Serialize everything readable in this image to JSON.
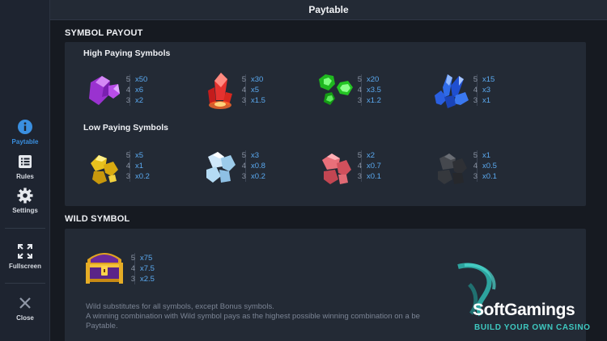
{
  "header": {
    "title": "Paytable"
  },
  "sidebar": {
    "items": [
      {
        "label": "Paytable",
        "icon": "info-icon",
        "active": true
      },
      {
        "label": "Rules",
        "icon": "list-icon"
      },
      {
        "label": "Settings",
        "icon": "gear-icon"
      },
      {
        "label": "Fullscreen",
        "icon": "fullscreen-icon"
      },
      {
        "label": "Close",
        "icon": "close-icon"
      }
    ]
  },
  "symbol_payout": {
    "title": "SYMBOL PAYOUT",
    "high": {
      "title": "High Paying Symbols",
      "symbols": [
        {
          "icon": "purple-crystal-icon",
          "color": "#b84de8",
          "pays": [
            {
              "n": "5",
              "v": "x50"
            },
            {
              "n": "4",
              "v": "x6"
            },
            {
              "n": "3",
              "v": "x2"
            }
          ]
        },
        {
          "icon": "red-crystal-icon",
          "color": "#e5322f",
          "pays": [
            {
              "n": "5",
              "v": "x30"
            },
            {
              "n": "4",
              "v": "x5"
            },
            {
              "n": "3",
              "v": "x1.5"
            }
          ]
        },
        {
          "icon": "green-gem-icon",
          "color": "#2fd12f",
          "pays": [
            {
              "n": "5",
              "v": "x20"
            },
            {
              "n": "4",
              "v": "x3.5"
            },
            {
              "n": "3",
              "v": "x1.2"
            }
          ]
        },
        {
          "icon": "blue-crystal-icon",
          "color": "#2f6be8",
          "pays": [
            {
              "n": "5",
              "v": "x15"
            },
            {
              "n": "4",
              "v": "x3"
            },
            {
              "n": "3",
              "v": "x1"
            }
          ]
        }
      ]
    },
    "low": {
      "title": "Low Paying Symbols",
      "symbols": [
        {
          "icon": "gold-ore-icon",
          "color": "#e8c21e",
          "pays": [
            {
              "n": "5",
              "v": "x5"
            },
            {
              "n": "4",
              "v": "x1"
            },
            {
              "n": "3",
              "v": "x0.2"
            }
          ]
        },
        {
          "icon": "ice-ore-icon",
          "color": "#a8d3ee",
          "pays": [
            {
              "n": "5",
              "v": "x3"
            },
            {
              "n": "4",
              "v": "x0.8"
            },
            {
              "n": "3",
              "v": "x0.2"
            }
          ]
        },
        {
          "icon": "red-ore-icon",
          "color": "#e0606a",
          "pays": [
            {
              "n": "5",
              "v": "x2"
            },
            {
              "n": "4",
              "v": "x0.7"
            },
            {
              "n": "3",
              "v": "x0.1"
            }
          ]
        },
        {
          "icon": "coal-ore-icon",
          "color": "#3a3d42",
          "pays": [
            {
              "n": "5",
              "v": "x1"
            },
            {
              "n": "4",
              "v": "x0.5"
            },
            {
              "n": "3",
              "v": "x0.1"
            }
          ]
        }
      ]
    }
  },
  "wild": {
    "title": "WILD SYMBOL",
    "icon": "treasure-chest-icon",
    "pays": [
      {
        "n": "5",
        "v": "x75"
      },
      {
        "n": "4",
        "v": "x7.5"
      },
      {
        "n": "3",
        "v": "x2.5"
      }
    ],
    "text_lines": [
      "Wild substitutes for all symbols, except Bonus symbols.",
      "A winning combination with Wild symbol pays as the highest possible winning combination on a be",
      "Paytable."
    ]
  },
  "watermark": {
    "name": "SoftGamings",
    "tagline": "BUILD YOUR OWN CASINO"
  }
}
